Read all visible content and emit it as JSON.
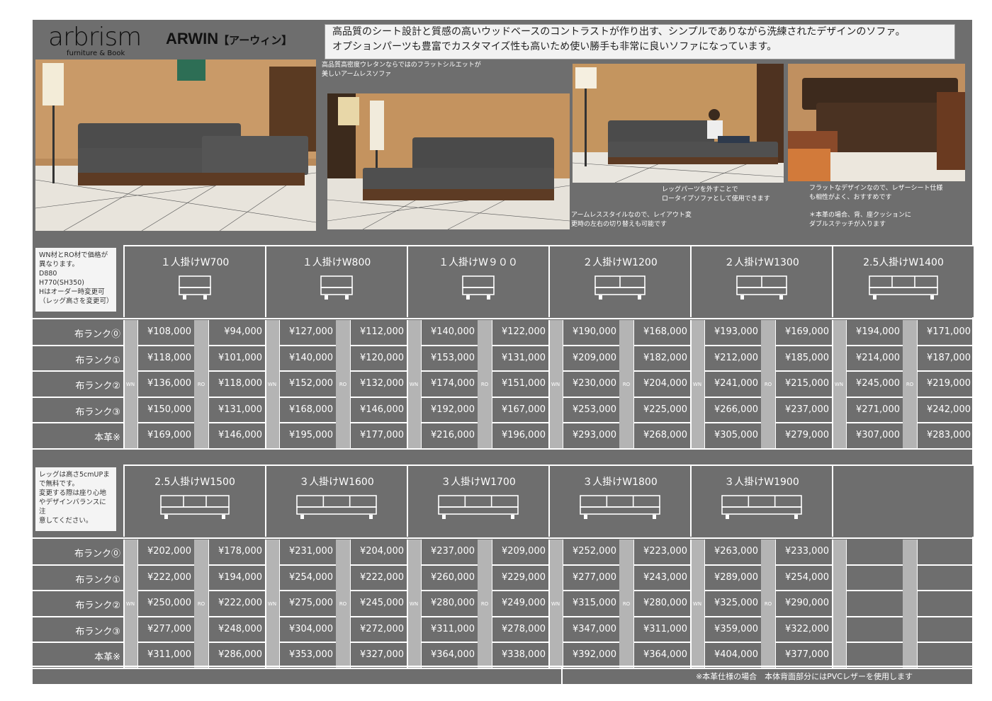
{
  "brand": {
    "logo": "arbrism",
    "sub": "furniture & Book"
  },
  "model": {
    "name": "ARWIN",
    "kana": "【アーウィン】"
  },
  "intro": [
    "高品質のシート設計と質感の高いウッドベースのコントラストが作り出す、シンプルでありながら洗練されたデザインのソファ。",
    "オプションパーツも豊富でカスタマイズ性も高いため使い勝手も非常に良いソファになっています。"
  ],
  "captions": {
    "photo2": [
      "高品質高密度ウレタンならではのフラットシルエットが",
      "美しいアームレスソファ"
    ],
    "photo3a": [
      "レッグパーツを外すことで",
      "ロータイプソファとして使用できます"
    ],
    "photo3b": [
      "アームレススタイルなので、レイアウト変",
      "更時の左右の切り替えも可能です"
    ],
    "photo4a": [
      "フラットなデザインなので、レザーシート仕様",
      "も相性がよく、おすすめです"
    ],
    "photo4b": [
      "＊本革の場合、背、座クッションに",
      "ダブルステッチが入ります"
    ]
  },
  "colors": {
    "panel": "#6e6e6e",
    "separator": "#b4b4b4",
    "note_bg": "#f4f4f4"
  },
  "wood_labels": {
    "wn": "WN",
    "ro": "RO"
  },
  "row_labels": [
    "布ランク⓪",
    "布ランク①",
    "布ランク②",
    "布ランク③",
    "本革※"
  ],
  "table1": {
    "note": [
      "WN材とRO材で価格が",
      "異なります。",
      "D880",
      "H770(SH350)",
      "Hはオーダー時変更可",
      "（レッグ高さを変更可）"
    ],
    "models": [
      {
        "title": "１人掛けW700",
        "seats": 1,
        "wn": [
          "¥108,000",
          "¥118,000",
          "¥136,000",
          "¥150,000",
          "¥169,000"
        ],
        "ro": [
          "¥94,000",
          "¥101,000",
          "¥118,000",
          "¥131,000",
          "¥146,000"
        ]
      },
      {
        "title": "１人掛けW800",
        "seats": 1,
        "wn": [
          "¥127,000",
          "¥140,000",
          "¥152,000",
          "¥168,000",
          "¥195,000"
        ],
        "ro": [
          "¥112,000",
          "¥120,000",
          "¥132,000",
          "¥146,000",
          "¥177,000"
        ]
      },
      {
        "title": "１人掛けW９００",
        "seats": 1,
        "wn": [
          "¥140,000",
          "¥153,000",
          "¥174,000",
          "¥192,000",
          "¥216,000"
        ],
        "ro": [
          "¥122,000",
          "¥131,000",
          "¥151,000",
          "¥167,000",
          "¥196,000"
        ]
      },
      {
        "title": "２人掛けW1200",
        "seats": 2,
        "wn": [
          "¥190,000",
          "¥209,000",
          "¥230,000",
          "¥253,000",
          "¥293,000"
        ],
        "ro": [
          "¥168,000",
          "¥182,000",
          "¥204,000",
          "¥225,000",
          "¥268,000"
        ]
      },
      {
        "title": "２人掛けW1300",
        "seats": 2,
        "wn": [
          "¥193,000",
          "¥212,000",
          "¥241,000",
          "¥266,000",
          "¥305,000"
        ],
        "ro": [
          "¥169,000",
          "¥185,000",
          "¥215,000",
          "¥237,000",
          "¥279,000"
        ]
      },
      {
        "title": "2.5人掛けW1400",
        "seats": 2.5,
        "wn": [
          "¥194,000",
          "¥214,000",
          "¥245,000",
          "¥271,000",
          "¥307,000"
        ],
        "ro": [
          "¥171,000",
          "¥187,000",
          "¥219,000",
          "¥242,000",
          "¥283,000"
        ]
      }
    ]
  },
  "table2": {
    "note": [
      "レッグは高さ5cmUPま",
      "で無料です。",
      "変更する際は座り心地",
      "やデザインバランスに注",
      "意してください。"
    ],
    "models": [
      {
        "title": "2.5人掛けW1500",
        "seats": 2.5,
        "wn": [
          "¥202,000",
          "¥222,000",
          "¥250,000",
          "¥277,000",
          "¥311,000"
        ],
        "ro": [
          "¥178,000",
          "¥194,000",
          "¥222,000",
          "¥248,000",
          "¥286,000"
        ]
      },
      {
        "title": "３人掛けW1600",
        "seats": 3,
        "wn": [
          "¥231,000",
          "¥254,000",
          "¥275,000",
          "¥304,000",
          "¥353,000"
        ],
        "ro": [
          "¥204,000",
          "¥222,000",
          "¥245,000",
          "¥272,000",
          "¥327,000"
        ]
      },
      {
        "title": "３人掛けW1700",
        "seats": 3,
        "wn": [
          "¥237,000",
          "¥260,000",
          "¥280,000",
          "¥311,000",
          "¥364,000"
        ],
        "ro": [
          "¥209,000",
          "¥229,000",
          "¥249,000",
          "¥278,000",
          "¥338,000"
        ]
      },
      {
        "title": "３人掛けW1800",
        "seats": 3,
        "wn": [
          "¥252,000",
          "¥277,000",
          "¥315,000",
          "¥347,000",
          "¥392,000"
        ],
        "ro": [
          "¥223,000",
          "¥243,000",
          "¥280,000",
          "¥311,000",
          "¥364,000"
        ]
      },
      {
        "title": "３人掛けW1900",
        "seats": 3,
        "wn": [
          "¥263,000",
          "¥289,000",
          "¥325,000",
          "¥359,000",
          "¥404,000"
        ],
        "ro": [
          "¥233,000",
          "¥254,000",
          "¥290,000",
          "¥322,000",
          "¥377,000"
        ]
      }
    ]
  },
  "footnote": "※本革仕様の場合　本体背面部分にはPVCレザーを使用します"
}
